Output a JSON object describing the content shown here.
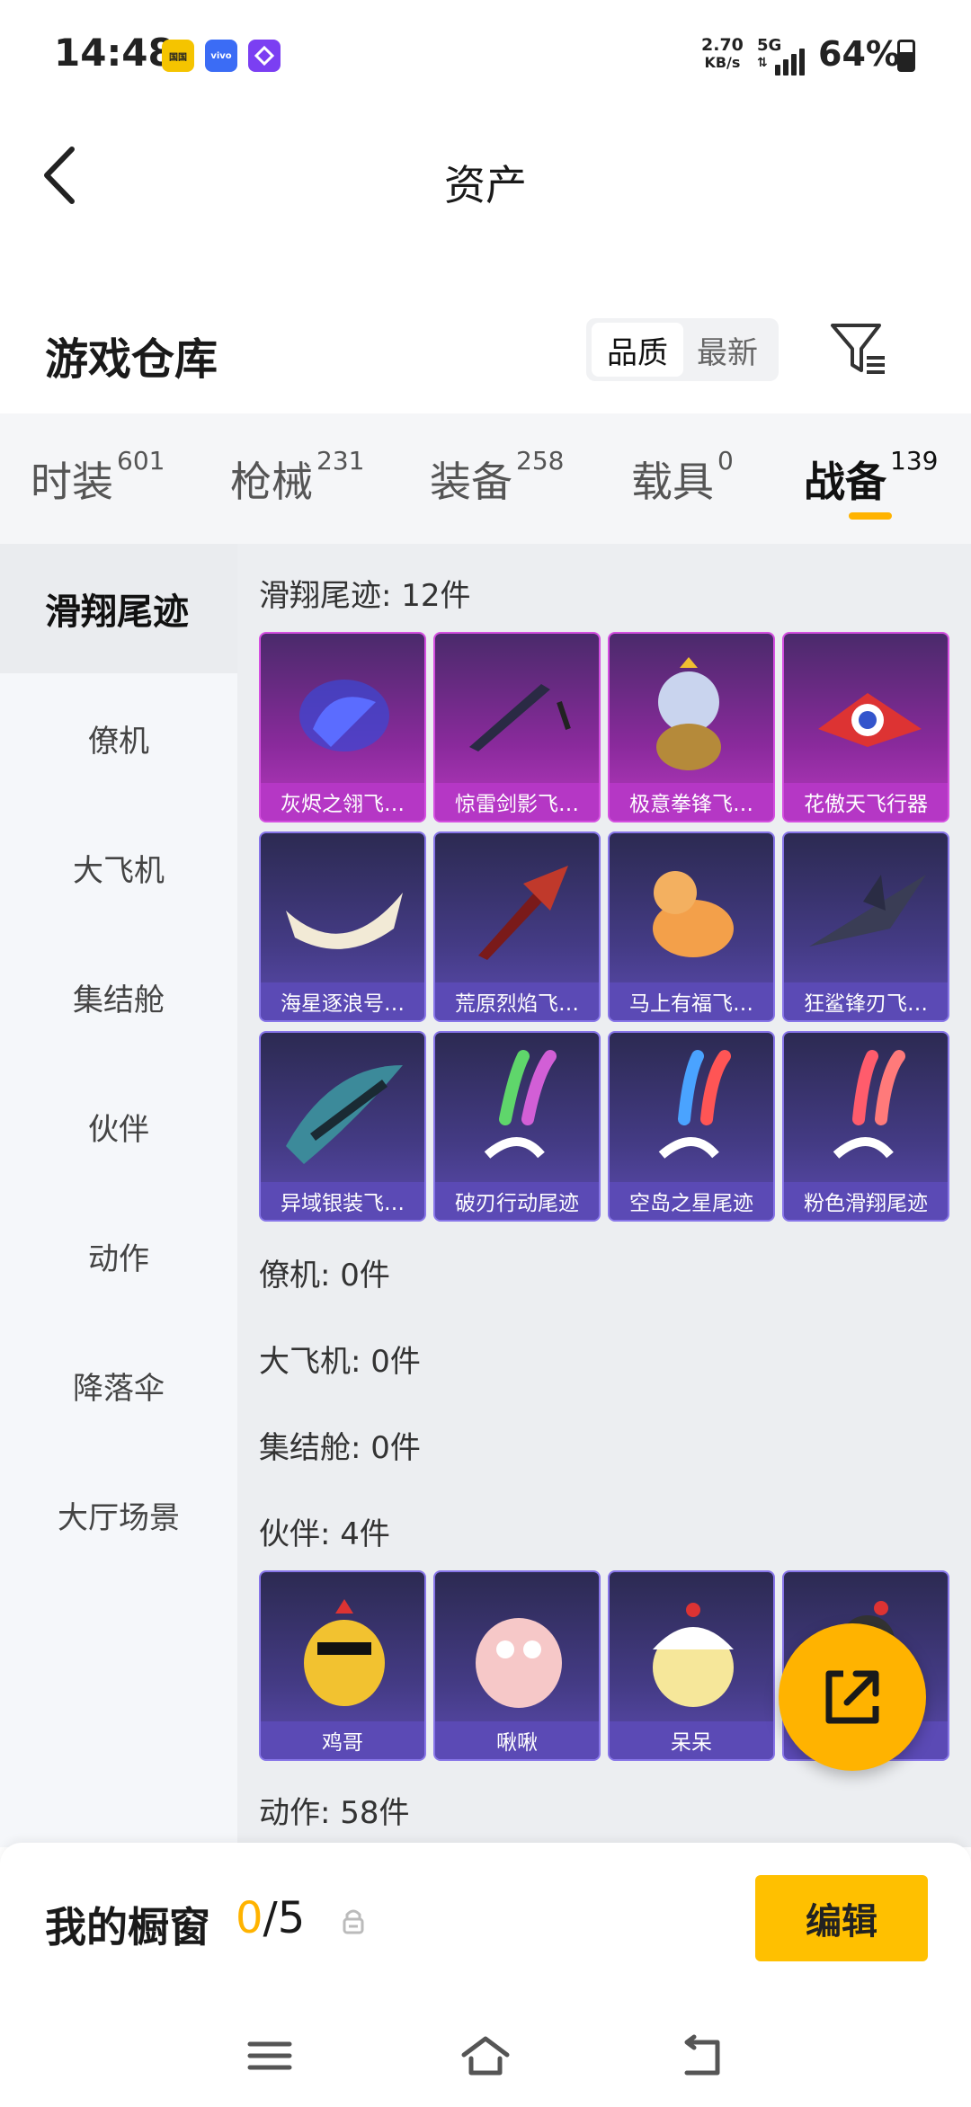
{
  "status_bar": {
    "time": "14:48",
    "net_speed_value": "2.70",
    "net_speed_unit": "KB/s",
    "network_type": "5G",
    "battery_percent": "64%",
    "battery_level": 0.64,
    "app_icon_1": "国国",
    "app_icon_2": "vivo"
  },
  "header": {
    "title": "资产"
  },
  "warehouse": {
    "title": "游戏仓库",
    "sort_options": [
      "品质",
      "最新"
    ],
    "selected_sort": "品质"
  },
  "tabs": [
    {
      "label": "时装",
      "count": "601"
    },
    {
      "label": "枪械",
      "count": "231"
    },
    {
      "label": "装备",
      "count": "258"
    },
    {
      "label": "载具",
      "count": "0"
    },
    {
      "label": "战备",
      "count": "139"
    }
  ],
  "active_tab": "战备",
  "sidebar": {
    "items": [
      "滑翔尾迹",
      "僚机",
      "大飞机",
      "集结舱",
      "伙伴",
      "动作",
      "降落伞",
      "大厅场景"
    ],
    "active": "滑翔尾迹"
  },
  "sections": {
    "glide_trail": {
      "title": "滑翔尾迹: 12件",
      "items": [
        {
          "name": "灰烬之翎飞…",
          "rarity": "pink"
        },
        {
          "name": "惊雷剑影飞…",
          "rarity": "pink"
        },
        {
          "name": "极意拳锋飞…",
          "rarity": "pink"
        },
        {
          "name": "花傲天飞行器",
          "rarity": "pink"
        },
        {
          "name": "海星逐浪号…",
          "rarity": "purple"
        },
        {
          "name": "荒原烈焰飞…",
          "rarity": "purple"
        },
        {
          "name": "马上有福飞…",
          "rarity": "purple"
        },
        {
          "name": "狂鲨锋刃飞…",
          "rarity": "purple"
        },
        {
          "name": "异域银装飞…",
          "rarity": "purple"
        },
        {
          "name": "破刃行动尾迹",
          "rarity": "purple"
        },
        {
          "name": "空岛之星尾迹",
          "rarity": "purple"
        },
        {
          "name": "粉色滑翔尾迹",
          "rarity": "purple"
        }
      ]
    },
    "wingman": {
      "title": "僚机: 0件"
    },
    "big_plane": {
      "title": "大飞机: 0件"
    },
    "assembly_pod": {
      "title": "集结舱: 0件"
    },
    "partner": {
      "title": "伙伴: 4件",
      "items": [
        {
          "name": "鸡哥",
          "rarity": "purple"
        },
        {
          "name": "啾啾",
          "rarity": "purple"
        },
        {
          "name": "呆呆",
          "rarity": "purple"
        },
        {
          "name": "",
          "rarity": "purple"
        }
      ]
    },
    "emote": {
      "title": "动作: 58件"
    }
  },
  "showcase": {
    "label": "我的橱窗",
    "current": "0",
    "max": "/5",
    "edit_label": "编辑"
  },
  "colors": {
    "accent": "#ffb300",
    "pink_card": "#b537c5",
    "purple_card": "#5b4ab5"
  }
}
